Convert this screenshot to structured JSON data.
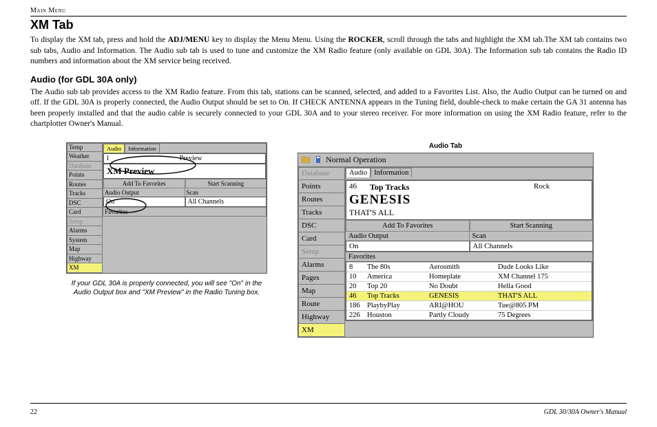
{
  "breadcrumb": "Main Menu",
  "title": "XM Tab",
  "para1_a": "To display the XM tab, press and hold the ",
  "para1_b": "ADJ/MENU",
  "para1_c": " key to display the Menu Menu. Using the ",
  "para1_d": "ROCKER",
  "para1_e": ", scroll through the tabs and highlight the XM tab.The XM tab contains two sub tabs, Audio and Information. The Audio sub tab is used to tune and customize the XM Radio feature (only available on GDL 30A). The Information sub tab contains the Radio ID numbers and information about the XM service being received.",
  "h2": "Audio (for GDL 30A only)",
  "para2": "The Audio sub tab provides access to the XM Radio feature. From this tab, stations can be scanned, selected, and added to a Favorites List. Also, the Audio Output can be turned on and off. If the GDL 30A is properly connected, the Audio Output should be set to On. If CHECK ANTENNA appears in the Tuning field, double-check to make certain the GA 31 antenna has been properly installed and that the audio cable is securely connected to your GDL 30A and to your stereo receiver.  For more information on using the XM Radio feature, refer to the chartplotter Owner's Manual.",
  "caption1": "If your GDL 30A is properly connected, you will see \"On\" in the Audio Output box and \"XM Preview\" in the Radio Tuning box.",
  "caption2": "Audio Tab",
  "footer_page": "22",
  "footer_manual": "GDL 30/30A Owner's Manual",
  "win1": {
    "sidebar": [
      "Temp",
      "Weather",
      "Database",
      "Points",
      "Routes",
      "Tracks",
      "DSC",
      "Card",
      "Setup",
      "Alarms",
      "System",
      "Map",
      "Highway",
      "XM"
    ],
    "dim_indices": [
      2,
      8
    ],
    "sel_index": 13,
    "tabs": [
      "Audio",
      "Information"
    ],
    "tuning_num": "1",
    "tuning_label": "Preview",
    "tuning_big": "XM Preview",
    "btn_fav": "Add To Favorites",
    "btn_scan": "Start Scanning",
    "lbl_output": "Audio Output",
    "lbl_scan": "Scan",
    "val_output": "On",
    "val_scan": "All Channels",
    "lbl_favorites": "Favorites"
  },
  "win2": {
    "title": "Normal Operation",
    "sidebar": [
      "Database",
      "Points",
      "Routes",
      "Tracks",
      "DSC",
      "Card",
      "Setup",
      "Alarms",
      "Pages",
      "Map",
      "Route",
      "Highway",
      "XM"
    ],
    "dim_indices": [
      0,
      6
    ],
    "sel_index": 12,
    "tabs": [
      "Audio",
      "Information"
    ],
    "ch_num": "46",
    "ch_name": "Top Tracks",
    "ch_genre": "Rock",
    "artist": "GENESIS",
    "song": "THAT'S ALL",
    "btn_fav": "Add To Favorites",
    "btn_scan": "Start Scanning",
    "lbl_output": "Audio Output",
    "lbl_scan": "Scan",
    "val_output": "On",
    "val_scan": "All Channels",
    "lbl_favorites": "Favorites",
    "favorites": [
      {
        "n": "8",
        "cat": "The 80s",
        "artist": "Aerosmith",
        "song": "Dude Looks Like"
      },
      {
        "n": "10",
        "cat": "America",
        "artist": "Homeplate",
        "song": "XM Channel 175"
      },
      {
        "n": "20",
        "cat": "Top 20",
        "artist": "No Doubt",
        "song": "Hella Good"
      },
      {
        "n": "46",
        "cat": "Top Tracks",
        "artist": "GENESIS",
        "song": "THAT'S ALL"
      },
      {
        "n": "186",
        "cat": "PlaybyPlay",
        "artist": "ARI@HOU",
        "song": "Tue@805 PM"
      },
      {
        "n": "226",
        "cat": "Houston",
        "artist": "Partly Cloudy",
        "song": "75 Degrees"
      }
    ],
    "fav_hl_index": 3
  }
}
